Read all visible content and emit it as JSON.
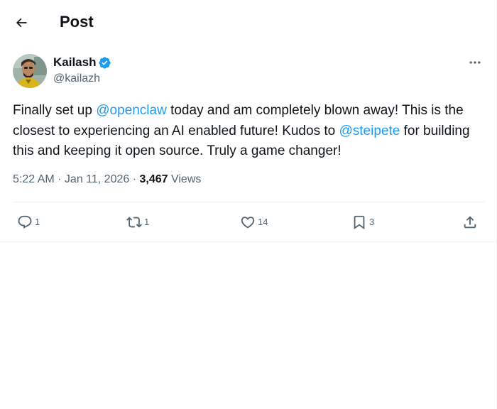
{
  "header": {
    "title": "Post",
    "back_icon": "arrow-left-icon"
  },
  "author": {
    "name": "Kailash",
    "handle": "@kailazh",
    "verified": true,
    "verified_color": "#1d9bf0"
  },
  "post": {
    "text_1": "Finally set up ",
    "mention_1": "@openclaw",
    "text_2": " today and am completely blown away! This is the closest to experiencing an AI enabled future! Kudos to ",
    "mention_2": "@steipete",
    "text_3": " for building this and keeping it open source. Truly a game changer!"
  },
  "meta": {
    "time": "5:22 AM",
    "separator_1": " · ",
    "date": "Jan 11, 2026",
    "separator_2": " · ",
    "views_count": "3,467",
    "views_label": " Views"
  },
  "actions": {
    "reply_count": "1",
    "repost_count": "1",
    "like_count": "14",
    "bookmark_count": "3"
  },
  "colors": {
    "text": "#0f1419",
    "secondary": "#536471",
    "accent": "#1d9bf0",
    "divider": "#eff3f4"
  }
}
